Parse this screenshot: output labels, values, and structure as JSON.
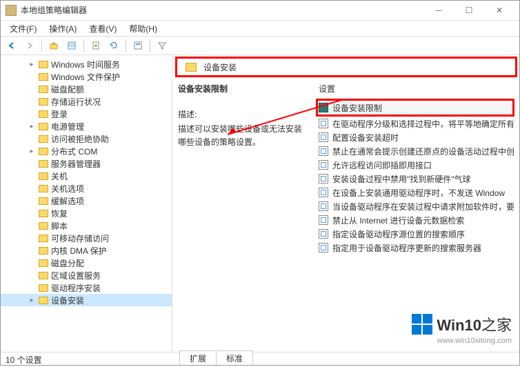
{
  "window": {
    "title": "本地组策略编辑器"
  },
  "menu": {
    "file": "文件(F)",
    "action": "操作(A)",
    "view": "查看(V)",
    "help": "帮助(H)"
  },
  "tree": {
    "items": [
      {
        "label": "Windows 时间服务",
        "expandable": true,
        "indent": 2
      },
      {
        "label": "Windows 文件保护",
        "expandable": false,
        "indent": 2
      },
      {
        "label": "磁盘配额",
        "expandable": false,
        "indent": 2
      },
      {
        "label": "存储运行状况",
        "expandable": false,
        "indent": 2
      },
      {
        "label": "登录",
        "expandable": false,
        "indent": 2
      },
      {
        "label": "电源管理",
        "expandable": true,
        "indent": 2
      },
      {
        "label": "访问被拒绝协助",
        "expandable": false,
        "indent": 2
      },
      {
        "label": "分布式 COM",
        "expandable": true,
        "indent": 2
      },
      {
        "label": "服务器管理器",
        "expandable": false,
        "indent": 2
      },
      {
        "label": "关机",
        "expandable": false,
        "indent": 2
      },
      {
        "label": "关机选项",
        "expandable": false,
        "indent": 2
      },
      {
        "label": "缓解选项",
        "expandable": false,
        "indent": 2
      },
      {
        "label": "恢复",
        "expandable": false,
        "indent": 2
      },
      {
        "label": "脚本",
        "expandable": false,
        "indent": 2
      },
      {
        "label": "可移动存储访问",
        "expandable": false,
        "indent": 2
      },
      {
        "label": "内核 DMA 保护",
        "expandable": false,
        "indent": 2
      },
      {
        "label": "磁盘分配",
        "expandable": false,
        "indent": 2
      },
      {
        "label": "区域设置服务",
        "expandable": false,
        "indent": 2
      },
      {
        "label": "驱动程序安装",
        "expandable": false,
        "indent": 2
      },
      {
        "label": "设备安装",
        "expandable": true,
        "indent": 2,
        "selected": true
      }
    ]
  },
  "header": {
    "path": "设备安装"
  },
  "detail": {
    "title": "设备安装限制",
    "desc_label": "描述:",
    "desc": "描述可以安装哪些设备或无法安装哪些设备的策略设置。"
  },
  "settings": {
    "column": "设置",
    "items": [
      {
        "label": "设备安装限制",
        "type": "folder",
        "highlighted": true
      },
      {
        "label": "在驱动程序分级和选择过程中，将平等地确定所有",
        "type": "policy"
      },
      {
        "label": "配置设备安装超时",
        "type": "policy"
      },
      {
        "label": "禁止在通常会提示创建还原点的设备活动过程中创",
        "type": "policy"
      },
      {
        "label": "允许远程访问即插即用接口",
        "type": "policy"
      },
      {
        "label": "安装设备过程中禁用\"找到新硬件\"气球",
        "type": "policy"
      },
      {
        "label": "在设备上安装通用驱动程序时，不发送 Window",
        "type": "policy"
      },
      {
        "label": "当设备驱动程序在安装过程中请求附加软件时，要",
        "type": "policy"
      },
      {
        "label": "禁止从 Internet 进行设备元数据检索",
        "type": "policy"
      },
      {
        "label": "指定设备驱动程序源位置的搜索顺序",
        "type": "policy"
      },
      {
        "label": "指定用于设备驱动程序更新的搜索服务器",
        "type": "policy"
      }
    ]
  },
  "tabs": {
    "extended": "扩展",
    "standard": "标准"
  },
  "status": {
    "count": "10 个设置"
  },
  "watermark": {
    "brand_prefix": "Win10",
    "brand_suffix": "之家",
    "url": "www.win10xitong.com"
  }
}
